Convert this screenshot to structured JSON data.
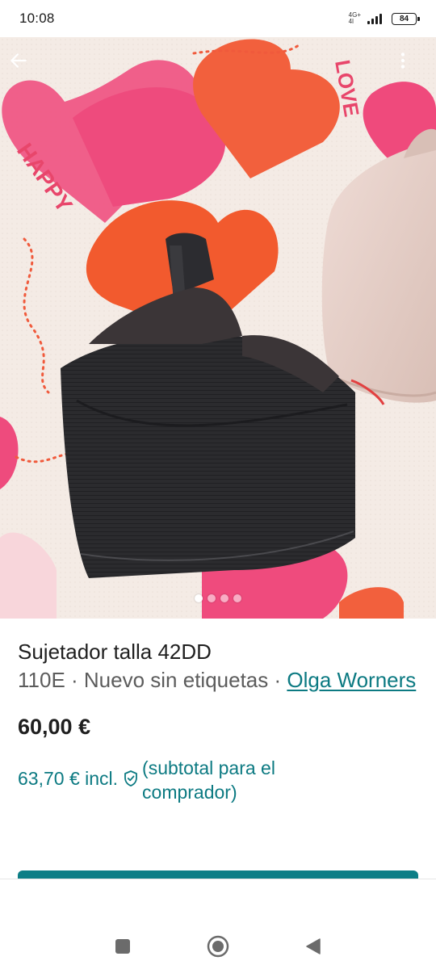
{
  "status_bar": {
    "time": "10:08",
    "network_top": "4G+",
    "network_bottom": "4l",
    "battery": "84"
  },
  "photo": {
    "icons": {
      "back": "arrow-left-icon",
      "more": "more-vertical-icon"
    },
    "carousel_count": 4,
    "carousel_active": 0,
    "background_text": [
      "HAPPY",
      "LOVE"
    ]
  },
  "listing": {
    "title": "Sujetador talla 42DD",
    "meta_prefix": "110E · Nuevo sin etiquetas · ",
    "brand": "Olga Worners",
    "price": "60,00 €",
    "price_incl": "63,70 € incl.",
    "subtotal_note": "(subtotal para el comprador)"
  },
  "colors": {
    "accent": "#0c7a82",
    "button": "#0d7e86"
  },
  "nav": {
    "icons": [
      "square-recent-icon",
      "circle-home-icon",
      "triangle-back-icon"
    ]
  }
}
